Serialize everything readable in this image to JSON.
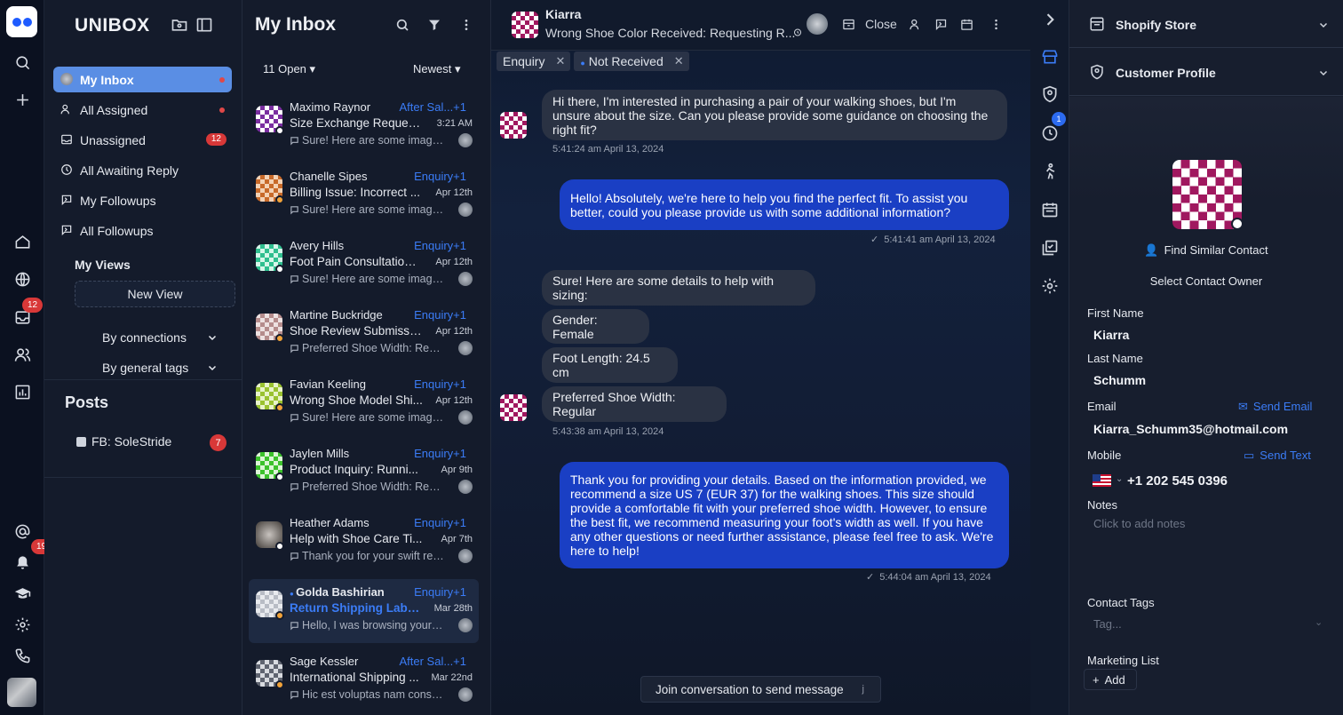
{
  "rail": {
    "badge_inbox": "12",
    "badge_notif": "19"
  },
  "sidebar": {
    "brand": "UNIBOX",
    "items": [
      {
        "label": "My Inbox"
      },
      {
        "label": "All Assigned"
      },
      {
        "label": "Unassigned",
        "badge": "12"
      },
      {
        "label": "All Awaiting Reply"
      },
      {
        "label": "My Followups"
      },
      {
        "label": "All Followups"
      }
    ],
    "my_views": "My Views",
    "new_view": "New View",
    "by_connections": "By connections",
    "by_general_tags": "By general tags",
    "posts_title": "Posts",
    "post_item": "FB: SoleStride",
    "post_badge": "7"
  },
  "inbox": {
    "title": "My Inbox",
    "filter_open": "11 Open",
    "sort": "Newest",
    "conversations": [
      {
        "name": "Maximo Raynor",
        "tag": "After Sal...+1",
        "subject": "Size Exchange Request...",
        "time": "3:21 AM",
        "preview": "Sure! Here are some images..."
      },
      {
        "name": "Chanelle Sipes",
        "tag": "Enquiry+1",
        "subject": "Billing Issue: Incorrect ...",
        "time": "Apr 12th",
        "preview": "Sure! Here are some images..."
      },
      {
        "name": "Avery Hills",
        "tag": "Enquiry+1",
        "subject": "Foot Pain Consultation:...",
        "time": "Apr 12th",
        "preview": "Sure! Here are some images..."
      },
      {
        "name": "Martine Buckridge",
        "tag": "Enquiry+1",
        "subject": "Shoe Review Submissio...",
        "time": "Apr 12th",
        "preview": "Preferred Shoe Width: Regul..."
      },
      {
        "name": "Favian Keeling",
        "tag": "Enquiry+1",
        "subject": "Wrong Shoe Model Shi...",
        "time": "Apr 12th",
        "preview": "Sure! Here are some images..."
      },
      {
        "name": "Jaylen Mills",
        "tag": "Enquiry+1",
        "subject": "Product Inquiry: Runni...",
        "time": "Apr 9th",
        "preview": "Preferred Shoe Width: Regul..."
      },
      {
        "name": "Heather Adams",
        "tag": "Enquiry+1",
        "subject": "Help with Shoe Care Ti...",
        "time": "Apr 7th",
        "preview": "Thank you for your swift res..."
      },
      {
        "name": "Golda Bashirian",
        "tag": "Enquiry+1",
        "subject": "Return Shipping Labe...",
        "time": "Mar 28th",
        "preview": "Hello, I was browsing your w..."
      },
      {
        "name": "Sage Kessler",
        "tag": "After Sal...+1",
        "subject": "International Shipping ...",
        "time": "Mar 22nd",
        "preview": "Hic est voluptas nam conse..."
      }
    ]
  },
  "chat": {
    "name": "Kiarra",
    "subject": "Wrong Shoe Color Received: Requesting R...",
    "close": "Close",
    "tags": [
      "Enquiry",
      "Not Received"
    ],
    "messages": [
      {
        "dir": "in",
        "text": "Hi there, I'm interested in purchasing a pair of your walking shoes, but I'm unsure about the size. Can you please provide some guidance on choosing the right fit?",
        "ts": "5:41:24 am April 13, 2024"
      },
      {
        "dir": "out",
        "text": "Hello! Absolutely, we're here to help you find the perfect fit. To assist you better, could you please provide us with some additional information?",
        "ts": "5:41:41 am April 13, 2024"
      },
      {
        "dir": "in",
        "text": "Sure! Here are some details to help with sizing:"
      },
      {
        "dir": "in",
        "text": "Gender: Female"
      },
      {
        "dir": "in",
        "text": "Foot Length: 24.5 cm"
      },
      {
        "dir": "in",
        "text": "Preferred Shoe Width: Regular",
        "ts": "5:43:38 am April 13, 2024"
      },
      {
        "dir": "out",
        "text": "Thank you for providing your details. Based on the information provided, we recommend a size US 7 (EUR 37) for the walking shoes. This size should provide a comfortable fit with your preferred shoe width. However, to ensure the best fit, we recommend measuring your foot's width as well. If you have any other questions or need further assistance, please feel free to ask. We're here to help!",
        "ts": "5:44:04 am April 13, 2024"
      }
    ],
    "join": "Join conversation to send message",
    "join_key": "j"
  },
  "strip": {
    "badge": "1"
  },
  "profile": {
    "shopify": "Shopify Store",
    "customer_profile": "Customer Profile",
    "find_similar": "Find Similar Contact",
    "select_owner": "Select Contact Owner",
    "first_name_label": "First Name",
    "first_name": "Kiarra",
    "last_name_label": "Last Name",
    "last_name": "Schumm",
    "email_label": "Email",
    "send_email": "Send Email",
    "email": "Kiarra_Schumm35@hotmail.com",
    "mobile_label": "Mobile",
    "send_text": "Send Text",
    "mobile": "+1 202 545 0396",
    "notes_label": "Notes",
    "notes_placeholder": "Click to add notes",
    "tags_label": "Contact Tags",
    "tags_placeholder": "Tag...",
    "marketing_label": "Marketing List",
    "add": "Add"
  },
  "colors": {
    "accent": "#3b7cf6",
    "outgoing": "#1a3fc4",
    "active_nav": "#5a8ee4",
    "badge": "#d83838"
  }
}
